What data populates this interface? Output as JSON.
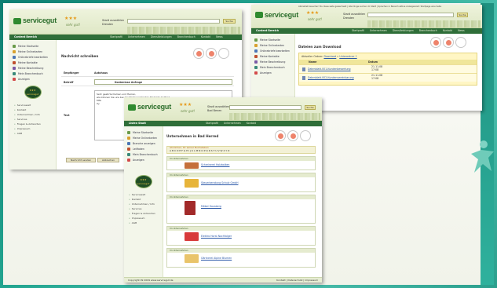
{
  "brand": {
    "name": "servicegut",
    "stars": "★★★",
    "tagline": "sehr gut!",
    "colors": {
      "green": "#2f6e39",
      "teal": "#23a590",
      "star": "#e69a1a"
    }
  },
  "screen_back_right": {
    "top_links": "Abmeldet besucher? Zu diese seite gewechselt | Alle Dinge suchen im Stadt | Sprachen in Bereich aktive Anzeigenzeit: Startpage eine Seite",
    "search_label_1": "Stadt auswählen",
    "search_label_2": "Dresden",
    "search_btn": "Suche",
    "nav_current": "Content Bereich",
    "nav_items": [
      "Startprofil",
      "Unternehmen",
      "Dienstleistungen",
      "Branchenbuch",
      "Kontakt",
      "News"
    ],
    "sidebar": [
      "Meine Startseite",
      "Meine Onlinekarten",
      "Onlinebriefe bearbeiten",
      "Meine Kontakte",
      "Meine Beschreibung",
      "Mein Branchenbuch",
      "Anzeigen"
    ],
    "page_title": "Dateien zum Download",
    "breadcrumb": {
      "prefix": "Aktueller Ordner:",
      "crumb1": "Download",
      "crumb2": "Unterordner 1"
    },
    "columns": [
      "Name",
      "Datum"
    ],
    "files": [
      {
        "name": "Datenblatt-001-Kundenbewertung",
        "date": "21.11.08\n17:08"
      },
      {
        "name": "Datenblatt-002-Kundenvereinbarung",
        "date": "21.11.08\n17:08"
      }
    ]
  },
  "screen_back_left": {
    "search_label_1": "Stadt auswählen",
    "search_label_2": "Dresden",
    "search_btn": "Suche",
    "nav_current": "Content Bereich",
    "nav_items": [
      "Startprofil",
      "Unternehmen",
      "Dienstleistungen",
      "Branchenbuch",
      "Kontakt",
      "News"
    ],
    "sidebar": [
      "Meine Startseite",
      "Meine Onlinekarten",
      "Onlinebriefe bearbeiten",
      "Meine Kontakte",
      "Meine Beschreibung",
      "Mein Branchenbuch",
      "Anzeigen"
    ],
    "badge_text": "★★★ servicegut",
    "sub_links": [
      "Servicewelt",
      "Kontakt",
      "Unternehmen / Info",
      "Services",
      "Fragen & Antworten",
      "Impressum",
      "AGB"
    ],
    "page_title": "Nachricht schreiben",
    "form": {
      "recipient_label": "Empfänger",
      "recipient_value": "Autohaus",
      "subject_label": "Betreff",
      "subject_value": "Kostenlose Anfrage",
      "text_label": "Text",
      "text_value": "Sehr geehrte Damen und Herren,\nwie können Sie uns bei der Werbung für Ihre Produkte helfen?\nMfG\nXy"
    },
    "buttons": {
      "send": "Nachricht senden",
      "cancel": "Abbrechen"
    }
  },
  "screen_front": {
    "search_label_1": "Stadt auswählen",
    "search_label_2": "Bad Benen",
    "search_btn": "Suche",
    "nav_current": "Listen Stadt",
    "nav_items": [
      "Startprofil",
      "Unternehmen",
      "Kontakt"
    ],
    "sidebar": [
      "Meine Startseite",
      "Meine Onlinekarten",
      "Branche anzeigen",
      "Leitfaden",
      "Mein Branchenbuch",
      "Anzeigen"
    ],
    "badge_text": "★★★ servicegut",
    "sub_links": [
      "Servicewelt",
      "Kontakt",
      "Unternehmen / Info",
      "Services",
      "Fragen & Antworten",
      "Impressum",
      "AGB"
    ],
    "page_title": "Unternehmen in Bad Herred",
    "filter_title": "Ähnlichen, Ihr seiner Buchstaben",
    "alphabet": "A B C D E F G H I J K L M N O P Q R S T U V W X Y Z",
    "companies": [
      {
        "tag": "Im Unternehmen",
        "name": "Schreinerei Holzbalken",
        "color": "#c5703a"
      },
      {
        "tag": "Im Unternehmen",
        "name": "Steuerberatung Schulz GmbH",
        "color": "#e7b43a"
      },
      {
        "tag": "Im Unternehmen",
        "name": "Möbel Hausberg",
        "color": "#a22a2a"
      },
      {
        "tag": "Im Unternehmen",
        "name": "Elektro Horst Nachfolger",
        "color": "#d83a3a"
      },
      {
        "tag": "Im Unternehmen",
        "name": "Gärtnerei Alpine Blumen",
        "color": "#e9c46a"
      }
    ],
    "footer_left": "Copyright 09 2009  www.servicegut.de",
    "footer_right": "Kontakt | Datenschutz | Impressum"
  }
}
